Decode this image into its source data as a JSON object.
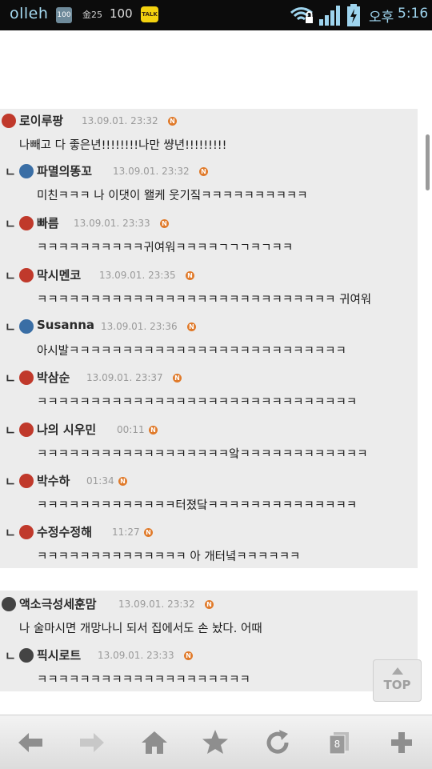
{
  "status_bar": {
    "carrier": "olleh",
    "battery_icon_text": "100",
    "gold_text": "金25",
    "hundred_text": "100",
    "talk_badge": "TALK",
    "ampm": "오후",
    "time": "5:16"
  },
  "comments": [
    {
      "author": "로이루팡",
      "date": "13.09.01. 23:32",
      "text": "나빼고 다 좋은년!!!!!!!!나만 썅년!!!!!!!!!",
      "reply": false,
      "avatar_color": "#c0392b"
    },
    {
      "author": "파멸의똥꼬",
      "date": "13.09.01. 23:32",
      "text": "미친ㅋㅋㅋ 나 이댓이 왤케 웃기짘ㅋㅋㅋㅋㅋㅋㅋㅋㅋㅋ",
      "reply": true,
      "avatar_color": "#3a6ea5"
    },
    {
      "author": "빠름",
      "date": "13.09.01. 23:33",
      "text": "ㅋㅋㅋㅋㅋㅋㅋㅋㅋㅋ귀여워ㅋㅋㅋㅋㄱㄱㄱㅋㄱㅋㅋ",
      "reply": true,
      "avatar_color": "#c0392b"
    },
    {
      "author": "막시멘코",
      "date": "13.09.01. 23:35",
      "text": "ㅋㅋㅋㅋㅋㅋㅋㅋㅋㅋㅋㅋㅋㅋㅋㅋㅋㅋㅋㅋㅋㅋㅋㅋㅋㅋㅋㅋ 귀여워",
      "reply": true,
      "avatar_color": "#c0392b"
    },
    {
      "author": "Susanna",
      "date": "13.09.01. 23:36",
      "text": "아시발ㅋㅋㅋㅋㅋㅋㅋㅋㅋㅋㅋㅋㅋㅋㅋㅋㅋㅋㅋㅋㅋㅋㅋㅋㅋㅋ",
      "reply": true,
      "avatar_color": "#3a6ea5"
    },
    {
      "author": "박삼순",
      "date": "13.09.01. 23:37",
      "text": "ㅋㅋㅋㅋㅋㅋㅋㅋㅋㅋㅋㅋㅋㅋㅋㅋㅋㅋㅋㅋㅋㅋㅋㅋㅋㅋㅋㅋㅋㅋ",
      "reply": true,
      "avatar_color": "#c0392b"
    },
    {
      "author": "나의 시우민",
      "date": "00:11",
      "text": "ㅋㅋㅋㅋㅋㅋㅋㅋㅋㅋㅋㅋㅋㅋㅋㅋㅋㅋ앜ㅋㅋㅋㅋㅋㅋㅋㅋㅋㅋㅋㅋ",
      "reply": true,
      "avatar_color": "#c0392b"
    },
    {
      "author": "박수하",
      "date": "01:34",
      "text": "ㅋㅋㅋㅋㅋㅋㅋㅋㅋㅋㅋㅋㅋ터졌닼ㅋㅋㅋㅋㅋㅋㅋㅋㅋㅋㅋㅋㅋㅋ",
      "reply": true,
      "avatar_color": "#c0392b"
    },
    {
      "author": "수정수정해",
      "date": "11:27",
      "text": "ㅋㅋㅋㅋㅋㅋㅋㅋㅋㅋㅋㅋㅋㅋ 아 개터녘ㅋㅋㅋㅋㅋㅋ",
      "reply": true,
      "avatar_color": "#c0392b"
    },
    {
      "author": "액소극성세훈맘",
      "date": "13.09.01. 23:32",
      "text": "나 술마시면 개망나니 되서 집에서도 손 놨다. 어때",
      "reply": false,
      "avatar_color": "#444444"
    },
    {
      "author": "픽시로트",
      "date": "13.09.01. 23:33",
      "text": "ㅋㅋㅋㅋㅋㅋㅋㅋㅋㅋㅋㅋㅋㅋㅋㅋㅋㅋㅋㅋ",
      "reply": true,
      "avatar_color": "#444444"
    }
  ],
  "badge_letter": "N",
  "reply_mark": "ㄴ",
  "top_button": {
    "label": "TOP"
  },
  "toolbar": {
    "tabs_count": "8",
    "buttons": [
      "back-icon",
      "forward-icon",
      "home-icon",
      "bookmark-star-icon",
      "refresh-icon",
      "tabs-icon",
      "plus-icon"
    ]
  }
}
